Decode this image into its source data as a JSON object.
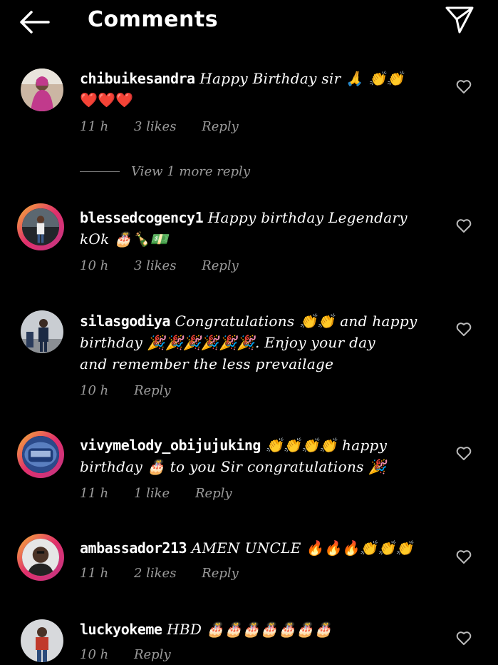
{
  "header": {
    "title": "Comments"
  },
  "comments": [
    {
      "user": "chibuikesandra",
      "text": "Happy Birthday sir 🙏 👏👏",
      "text2": "❤️❤️❤️",
      "time": "11 h",
      "likes": "3 likes",
      "reply": "Reply",
      "view_more": "View 1 more reply"
    },
    {
      "user": "blessedcogency1",
      "text": "Happy birthday Legendary",
      "text2": "kOk 🎂🍾💵",
      "time": "10 h",
      "likes": "3 likes",
      "reply": "Reply"
    },
    {
      "user": "silasgodiya",
      "text": "Congratulations 👏👏 and happy",
      "text2": "birthday 🎉🎉🎉🎉🎉🎉. Enjoy your day",
      "text3": "and remember the less prevailage",
      "time": "10 h",
      "reply": "Reply"
    },
    {
      "user": "vivymelody_obijujuking",
      "text": "👏👏👏👏 happy",
      "text2": "birthday 🎂 to you Sir congratulations 🎉",
      "time": "11 h",
      "likes": "1 like",
      "reply": "Reply"
    },
    {
      "user": "ambassador213",
      "text": "AMEN UNCLE 🔥🔥🔥👏👏👏",
      "time": "11 h",
      "likes": "2 likes",
      "reply": "Reply"
    },
    {
      "user": "luckyokeme",
      "text": "HBD 🎂🎂🎂🎂🎂🎂🎂",
      "time": "10 h",
      "reply": "Reply"
    }
  ],
  "icons": {
    "back": "back-arrow-icon",
    "send": "send-icon",
    "heart": "heart-outline-icon"
  }
}
